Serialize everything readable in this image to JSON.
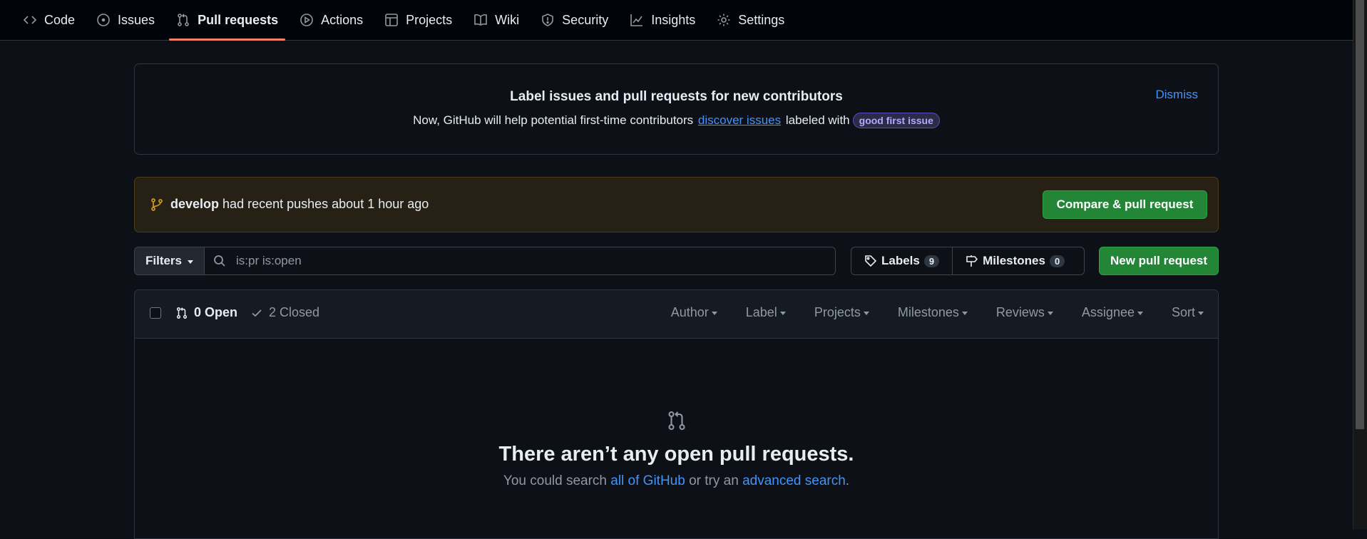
{
  "nav": {
    "tabs": [
      {
        "label": "Code",
        "icon": "code-icon"
      },
      {
        "label": "Issues",
        "icon": "issue-icon"
      },
      {
        "label": "Pull requests",
        "icon": "pull-request-icon",
        "active": true
      },
      {
        "label": "Actions",
        "icon": "play-icon"
      },
      {
        "label": "Projects",
        "icon": "table-icon"
      },
      {
        "label": "Wiki",
        "icon": "book-icon"
      },
      {
        "label": "Security",
        "icon": "shield-icon"
      },
      {
        "label": "Insights",
        "icon": "graph-icon"
      },
      {
        "label": "Settings",
        "icon": "gear-icon"
      }
    ]
  },
  "contributor_banner": {
    "title": "Label issues and pull requests for new contributors",
    "text_before": "Now, GitHub will help potential first-time contributors",
    "link": "discover issues",
    "text_after": "labeled with",
    "label": "good first issue",
    "dismiss": "Dismiss"
  },
  "push_banner": {
    "branch": "develop",
    "text": "had recent pushes about 1 hour ago",
    "button": "Compare & pull request"
  },
  "filter_bar": {
    "filters_label": "Filters",
    "search_value": "",
    "search_placeholder": "is:pr is:open",
    "labels_label": "Labels",
    "labels_count": "9",
    "milestones_label": "Milestones",
    "milestones_count": "0",
    "new_pr_button": "New pull request"
  },
  "list": {
    "open_label": "0 Open",
    "closed_label": "2 Closed",
    "sort_options": [
      "Author",
      "Label",
      "Projects",
      "Milestones",
      "Reviews",
      "Assignee",
      "Sort"
    ]
  },
  "blankslate": {
    "title": "There aren’t any open pull requests.",
    "sub_before": "You could search",
    "link1": "all of GitHub",
    "sub_middle": "or try an",
    "link2": "advanced search",
    "sub_after": "."
  },
  "colors": {
    "accent": "#f78166",
    "link": "#4493f8",
    "primary_button": "#238636",
    "background": "#0d1117"
  }
}
